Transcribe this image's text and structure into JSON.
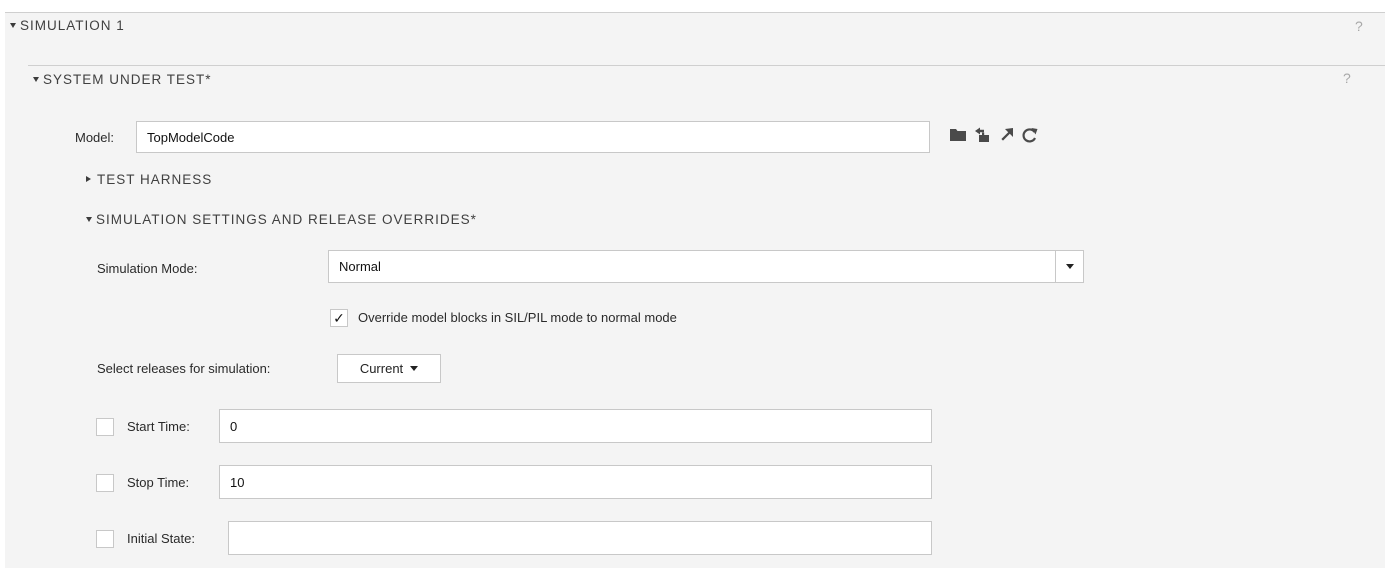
{
  "simulation": {
    "header": "SIMULATION 1",
    "help": "?"
  },
  "system_under_test": {
    "header": "SYSTEM UNDER TEST*",
    "help": "?",
    "model_label": "Model:",
    "model_value": "TopModelCode",
    "toolbar_icons": [
      "folder-icon",
      "open-model-icon",
      "navigate-to-icon",
      "refresh-icon"
    ]
  },
  "test_harness": {
    "header": "TEST HARNESS"
  },
  "sim_settings": {
    "header": "SIMULATION SETTINGS AND RELEASE OVERRIDES*",
    "mode_label": "Simulation Mode:",
    "mode_value": "Normal",
    "override_checkbox": {
      "checked": true,
      "check_glyph": "✓",
      "label": "Override model blocks in SIL/PIL mode to normal mode"
    },
    "releases_label": "Select releases for simulation:",
    "releases_value": "Current",
    "start_time": {
      "checked": false,
      "label": "Start Time:",
      "value": "0"
    },
    "stop_time": {
      "checked": false,
      "label": "Stop Time:",
      "value": "10"
    },
    "initial_state": {
      "checked": false,
      "label": "Initial State:",
      "value": ""
    }
  },
  "colors": {
    "panel_bg": "#f4f4f4",
    "border": "#c8c8c8",
    "header_text": "#404040",
    "help_icon": "#a8a8a8",
    "icon": "#4a4a4a"
  }
}
